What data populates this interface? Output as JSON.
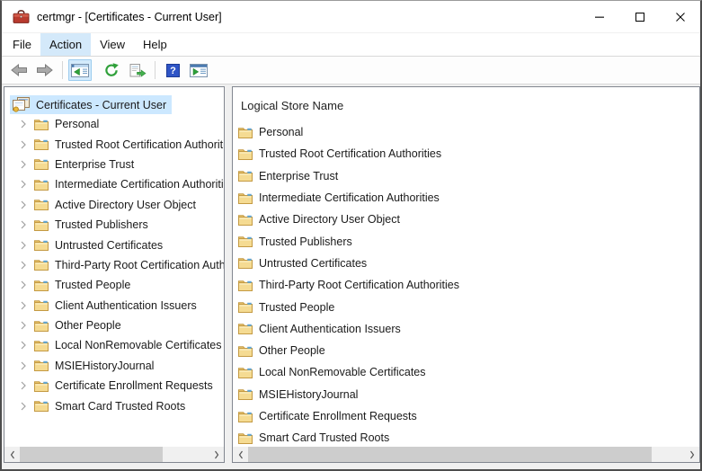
{
  "window": {
    "title": "certmgr - [Certificates - Current User]"
  },
  "menu": {
    "items": [
      "File",
      "Action",
      "View",
      "Help"
    ],
    "active_item": "Action"
  },
  "toolbar": {
    "buttons": [
      {
        "name": "back",
        "enabled": false
      },
      {
        "name": "forward",
        "enabled": false
      },
      {
        "name": "show-hide-console-tree",
        "active": true
      },
      {
        "name": "refresh",
        "enabled": true
      },
      {
        "name": "export-list",
        "enabled": true
      },
      {
        "name": "help",
        "enabled": true
      },
      {
        "name": "show-hide-action-pane",
        "enabled": true
      }
    ]
  },
  "tree": {
    "root_label": "Certificates - Current User",
    "items": [
      "Personal",
      "Trusted Root Certification Authorities",
      "Enterprise Trust",
      "Intermediate Certification Authorities",
      "Active Directory User Object",
      "Trusted Publishers",
      "Untrusted Certificates",
      "Third-Party Root Certification Authorities",
      "Trusted People",
      "Client Authentication Issuers",
      "Other People",
      "Local NonRemovable Certificates",
      "MSIEHistoryJournal",
      "Certificate Enrollment Requests",
      "Smart Card Trusted Roots"
    ]
  },
  "list": {
    "header": "Logical Store Name",
    "items": [
      "Personal",
      "Trusted Root Certification Authorities",
      "Enterprise Trust",
      "Intermediate Certification Authorities",
      "Active Directory User Object",
      "Trusted Publishers",
      "Untrusted Certificates",
      "Third-Party Root Certification Authorities",
      "Trusted People",
      "Client Authentication Issuers",
      "Other People",
      "Local NonRemovable Certificates",
      "MSIEHistoryJournal",
      "Certificate Enrollment Requests",
      "Smart Card Trusted Roots"
    ]
  },
  "colors": {
    "selection_blue": "#cce8ff",
    "menu_highlight": "#d4e9fa",
    "folder_yellow": "#f5db92",
    "help_blue": "#2e54c6",
    "refresh_green": "#2fa03a",
    "toolbox_red": "#b93a2e"
  }
}
